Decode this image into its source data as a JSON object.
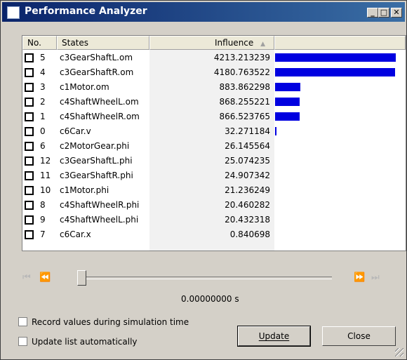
{
  "window": {
    "title": "Performance Analyzer"
  },
  "controls": {
    "minimize": "_",
    "maximize": "□",
    "close": "✕"
  },
  "columns": {
    "no": "No.",
    "states": "States",
    "influence": "Influence",
    "sort_icon": "▲"
  },
  "rows": [
    {
      "no": "5",
      "state": "c3GearShaftL.om",
      "influence": "4213.213239",
      "bar": 1.0
    },
    {
      "no": "4",
      "state": "c3GearShaftR.om",
      "influence": "4180.763522",
      "bar": 0.992
    },
    {
      "no": "3",
      "state": "c1Motor.om",
      "influence": "883.862298",
      "bar": 0.21
    },
    {
      "no": "2",
      "state": "c4ShaftWheelL.om",
      "influence": "868.255221",
      "bar": 0.206
    },
    {
      "no": "1",
      "state": "c4ShaftWheelR.om",
      "influence": "866.523765",
      "bar": 0.206
    },
    {
      "no": "0",
      "state": "c6Car.v",
      "influence": "32.271184",
      "bar": 0.008
    },
    {
      "no": "6",
      "state": "c2MotorGear.phi",
      "influence": "26.145564",
      "bar": 0
    },
    {
      "no": "12",
      "state": "c3GearShaftL.phi",
      "influence": "25.074235",
      "bar": 0
    },
    {
      "no": "11",
      "state": "c3GearShaftR.phi",
      "influence": "24.907342",
      "bar": 0
    },
    {
      "no": "10",
      "state": "c1Motor.phi",
      "influence": "21.236249",
      "bar": 0
    },
    {
      "no": "8",
      "state": "c4ShaftWheelR.phi",
      "influence": "20.460282",
      "bar": 0
    },
    {
      "no": "9",
      "state": "c4ShaftWheelL.phi",
      "influence": "20.432318",
      "bar": 0
    },
    {
      "no": "7",
      "state": "c6Car.x",
      "influence": "0.840698",
      "bar": 0
    }
  ],
  "playback": {
    "first": "⏮",
    "prev": "⏪",
    "next": "⏩",
    "last": "⏭",
    "time": "0.00000000 s",
    "slider_position": 0
  },
  "options": {
    "record_label": "Record values during simulation time",
    "auto_update_label": "Update list automatically"
  },
  "buttons": {
    "update": "Update",
    "close": "Close"
  },
  "colors": {
    "bar": "#0000e0",
    "title_start": "#0a246a",
    "title_end": "#3a6ea5"
  }
}
